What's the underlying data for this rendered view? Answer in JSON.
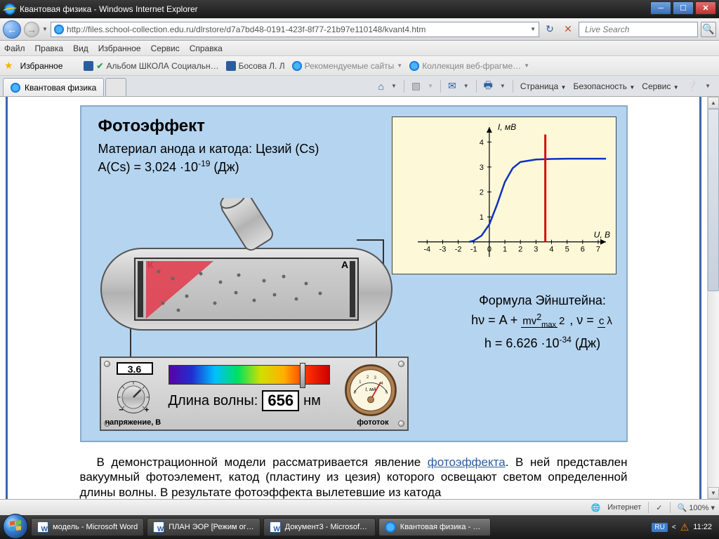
{
  "window": {
    "title": "Квантовая физика - Windows Internet Explorer"
  },
  "nav": {
    "url": "http://files.school-collection.edu.ru/dlrstore/d7a7bd48-0191-423f-8f77-21b97e110148/kvant4.htm"
  },
  "search": {
    "placeholder": "Live Search"
  },
  "menu": {
    "file": "Файл",
    "edit": "Правка",
    "view": "Вид",
    "fav": "Избранное",
    "tools": "Сервис",
    "help": "Справка"
  },
  "favbar": {
    "label": "Избранное",
    "items": [
      "Альбом ШКОЛА Социальн…",
      "Босова Л. Л",
      "Рекомендуемые сайты",
      "Коллекция веб-фрагме…"
    ]
  },
  "tab": {
    "title": "Квантовая физика"
  },
  "cmdbar": {
    "page": "Страница",
    "safety": "Безопасность",
    "service": "Сервис"
  },
  "sim": {
    "title": "Фотоэффект",
    "material": "Материал анода и катода: Цезий (Cs)",
    "workfn": "A(Cs) = 3,024 ·10",
    "workfn_exp": "-19",
    "workfn_unit": " (Дж)",
    "einstein_title": "Формула Эйнштейна:",
    "einstein_1": "hν = A + ",
    "ein_num": "mv",
    "ein_sup": "2",
    "ein_sub": "max",
    "ein_den": "2",
    "einstein_2": " , ν = ",
    "c": "c",
    "lambda": "λ",
    "h_line": "h = 6.626 ·10",
    "h_exp": "-34",
    "h_unit": " (Дж)",
    "voltage_value": "3.6",
    "voltage_label": "напряжение, В",
    "wavelength_label": "Длина волны:",
    "wavelength_value": "656",
    "wavelength_unit": "нм",
    "meter_label": "фототок",
    "K": "К",
    "A": "А"
  },
  "chart_data": {
    "type": "line",
    "title": "",
    "xlabel": "U, В",
    "ylabel": "I, мВ",
    "x_ticks": [
      -4,
      -3,
      -2,
      -1,
      0,
      1,
      2,
      3,
      4,
      5,
      6,
      7
    ],
    "y_ticks": [
      1,
      2,
      3,
      4
    ],
    "xlim": [
      -4.6,
      7.5
    ],
    "ylim": [
      -0.6,
      4.6
    ],
    "series": [
      {
        "name": "I(U)",
        "color": "#1030c0",
        "x": [
          -1.3,
          -1.0,
          -0.5,
          0.0,
          0.5,
          1.0,
          1.5,
          2.0,
          3.0,
          4.0,
          5.0,
          6.0,
          7.0,
          7.5
        ],
        "y": [
          0.0,
          0.05,
          0.25,
          0.7,
          1.5,
          2.4,
          2.95,
          3.2,
          3.3,
          3.32,
          3.33,
          3.33,
          3.33,
          3.33
        ]
      }
    ],
    "marker_x": 3.6,
    "marker_ymax": 4.3
  },
  "description": {
    "p1a": "В демонстрационной модели рассматривается явление ",
    "link": "фотоэффекта",
    "p1b": ". В ней представлен вакуумный фотоэлемент, катод (пластину из цезия) которого освещают светом определенной длины волны. В результате фотоэффекта вылетевшие из катода"
  },
  "status": {
    "net": "Интернет",
    "zoom": "100%"
  },
  "taskbar": {
    "b1": "модель - Microsoft Word",
    "b2": "ПЛАН ЭОР [Режим ог…",
    "b3": "Документ3 - Microsof…",
    "b4": "Квантовая физика - …"
  },
  "tray": {
    "lang": "RU",
    "time": "11:22"
  }
}
